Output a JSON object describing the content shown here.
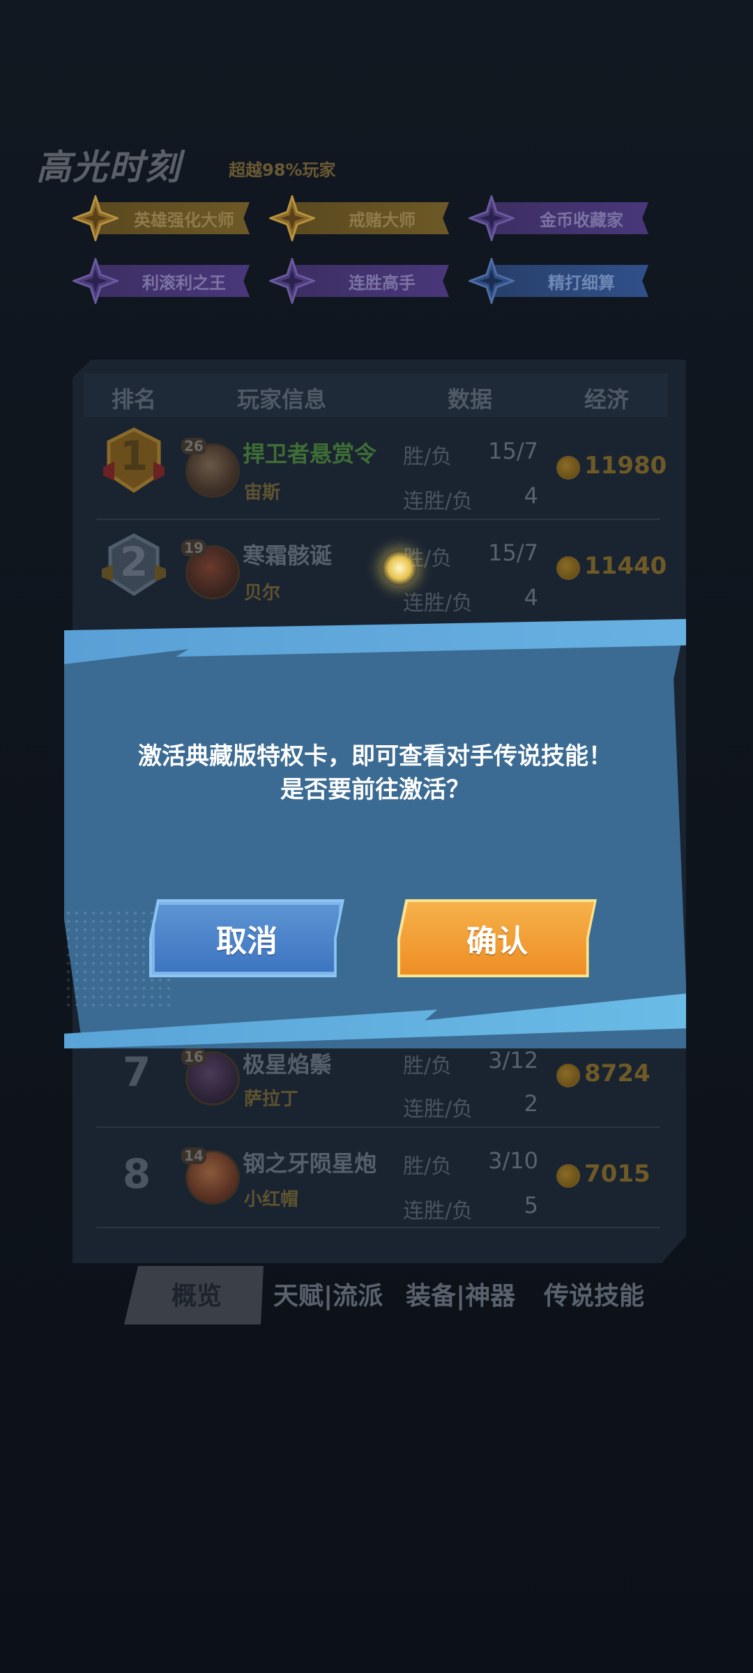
{
  "highlight": {
    "title": "高光时刻",
    "subtitle": "超越98%玩家",
    "badges": [
      {
        "label": "英雄强化大师",
        "style": "gold"
      },
      {
        "label": "戒赌大师",
        "style": "gold"
      },
      {
        "label": "金币收藏家",
        "style": "purple"
      },
      {
        "label": "利滚利之王",
        "style": "purple"
      },
      {
        "label": "连胜高手",
        "style": "purple"
      },
      {
        "label": "精打细算",
        "style": "blue"
      }
    ]
  },
  "table": {
    "headers": [
      "排名",
      "玩家信息",
      "数据",
      "经济"
    ],
    "stat_labels": {
      "win_loss": "胜/负",
      "streak": "连胜/负"
    },
    "rows": [
      {
        "rank": "1",
        "level": "26",
        "name": "捍卫者悬赏令",
        "hero": "宙斯",
        "win_loss": "15/7",
        "streak": "4",
        "gold": "11980"
      },
      {
        "rank": "2",
        "level": "19",
        "name": "寒霜骸诞",
        "hero": "贝尔",
        "win_loss": "15/7",
        "streak": "4",
        "gold": "11440"
      },
      {
        "rank": "7",
        "level": "16",
        "name": "极星焰鬃",
        "hero": "萨拉丁",
        "win_loss": "3/12",
        "streak": "2",
        "gold": "8724"
      },
      {
        "rank": "8",
        "level": "14",
        "name": "钢之牙陨星炮",
        "hero": "小红帽",
        "win_loss": "3/10",
        "streak": "5",
        "gold": "7015"
      }
    ]
  },
  "tabs": [
    "概览",
    "天赋|流派",
    "装备|神器",
    "传说技能"
  ],
  "modal": {
    "line1": "激活典藏版特权卡，即可查看对手传说技能！",
    "line2": "是否要前往激活？",
    "cancel": "取消",
    "confirm": "确认"
  },
  "colors": {
    "modal_bg": "#3b6b93",
    "cancel_button": "#4a82c8",
    "confirm_button": "#f2a03a"
  }
}
